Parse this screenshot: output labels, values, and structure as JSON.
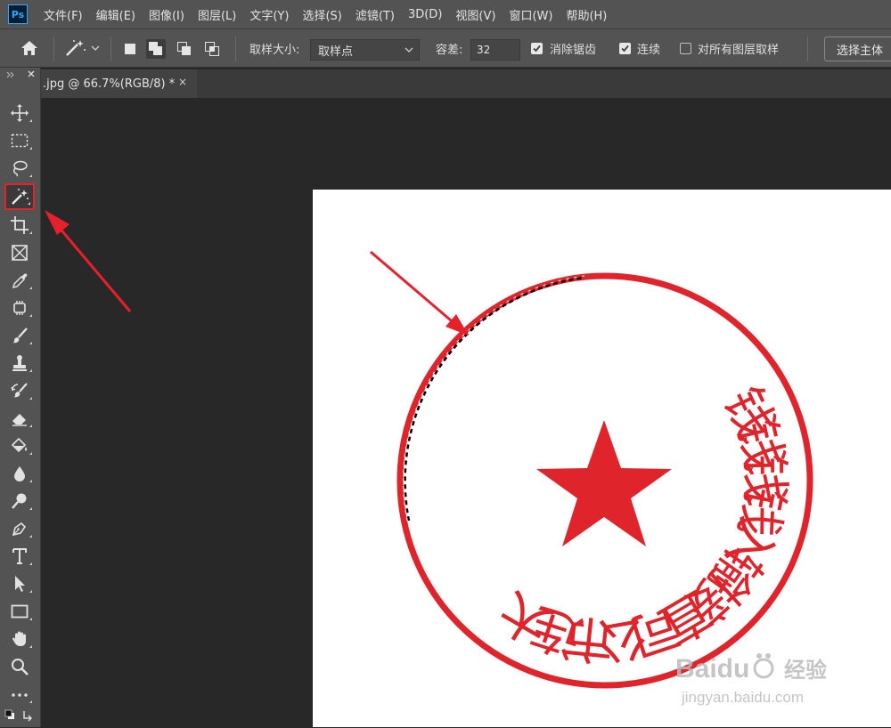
{
  "app": {
    "logo_text": "Ps"
  },
  "menu": [
    "文件(F)",
    "编辑(E)",
    "图像(I)",
    "图层(L)",
    "文字(Y)",
    "选择(S)",
    "滤镜(T)",
    "3D(D)",
    "视图(V)",
    "窗口(W)",
    "帮助(H)"
  ],
  "options": {
    "sample_size_label": "取样大小:",
    "sample_size_value": "取样点",
    "tolerance_label": "容差:",
    "tolerance_value": "32",
    "anti_alias_label": "消除锯齿",
    "anti_alias_checked": true,
    "contiguous_label": "连续",
    "contiguous_checked": true,
    "sample_all_layers_label": "对所有图层取样",
    "sample_all_layers_checked": false,
    "select_subject_label": "选择主体"
  },
  "toolbar": {
    "active_tool": "magic-wand-tool",
    "highlight_color": "#e0242b",
    "tools": [
      "move-tool",
      "marquee-tool",
      "lasso-tool",
      "magic-wand-tool",
      "crop-tool",
      "frame-tool",
      "eyedropper-tool",
      "healing-tool",
      "brush-tool",
      "stamp-tool",
      "history-brush-tool",
      "eraser-tool",
      "paint-bucket-tool",
      "blur-tool",
      "dodge-tool",
      "pen-tool",
      "type-tool",
      "path-selection-tool",
      "rectangle-tool",
      "hand-tool",
      "zoom-tool",
      "more-tools",
      "color-swatches"
    ]
  },
  "document": {
    "tab_title": ".jpg @ 66.7%(RGB/8) *",
    "tab_close": "×",
    "background_color": "#ffffff"
  },
  "stamp": {
    "color": "#e0242b",
    "text_arc": "大连市公司直接输入钱钱钱钱"
  },
  "annotations": {
    "arrow_color": "#e8202a"
  },
  "watermark": {
    "brand": "Baidu",
    "brand_cn": "经验",
    "url": "jingyan.baidu.com"
  }
}
